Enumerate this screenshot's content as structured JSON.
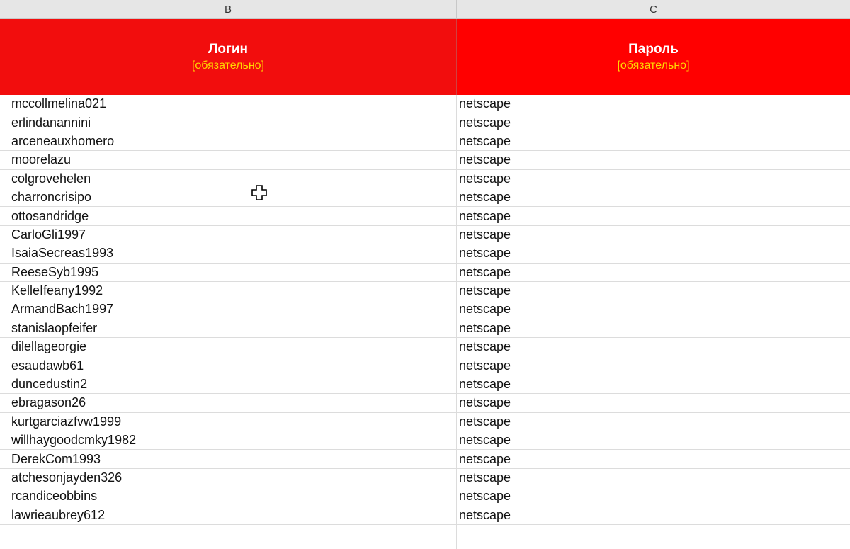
{
  "columns": {
    "b": "B",
    "c": "C"
  },
  "header": {
    "login_title": "Логин",
    "login_note": "[обязательно]",
    "password_title": "Пароль",
    "password_note": "[обязательно]",
    "login_bg": "#f20d0d",
    "password_bg": "#ff0000",
    "note_color": "#ffd700"
  },
  "rows": [
    {
      "login": "mccollmelina021",
      "password": "netscape"
    },
    {
      "login": "erlindanannini",
      "password": "netscape"
    },
    {
      "login": "arceneauxhomero",
      "password": "netscape"
    },
    {
      "login": "moorelazu",
      "password": "netscape"
    },
    {
      "login": "colgrovehelen",
      "password": "netscape"
    },
    {
      "login": "charroncrisipo",
      "password": "netscape"
    },
    {
      "login": "ottosandridge",
      "password": "netscape"
    },
    {
      "login": "CarloGli1997",
      "password": "netscape"
    },
    {
      "login": "IsaiaSecreas1993",
      "password": "netscape"
    },
    {
      "login": "ReeseSyb1995",
      "password": "netscape"
    },
    {
      "login": "KelleIfeany1992",
      "password": "netscape"
    },
    {
      "login": "ArmandBach1997",
      "password": "netscape"
    },
    {
      "login": "stanislaopfeifer",
      "password": "netscape"
    },
    {
      "login": "dilellageorgie",
      "password": "netscape"
    },
    {
      "login": "esaudawb61",
      "password": "netscape"
    },
    {
      "login": "duncedustin2",
      "password": "netscape"
    },
    {
      "login": "ebragason26",
      "password": "netscape"
    },
    {
      "login": "kurtgarciazfvw1999",
      "password": "netscape"
    },
    {
      "login": "willhaygoodcmky1982",
      "password": "netscape"
    },
    {
      "login": "DerekCom1993",
      "password": "netscape"
    },
    {
      "login": "atchesonjayden326",
      "password": "netscape"
    },
    {
      "login": "rcandiceobbins",
      "password": "netscape"
    },
    {
      "login": "lawrieaubrey612",
      "password": "netscape"
    },
    {
      "login": "",
      "password": ""
    },
    {
      "login": "",
      "password": ""
    }
  ],
  "cursor_icon": "cell-select-cross-icon"
}
